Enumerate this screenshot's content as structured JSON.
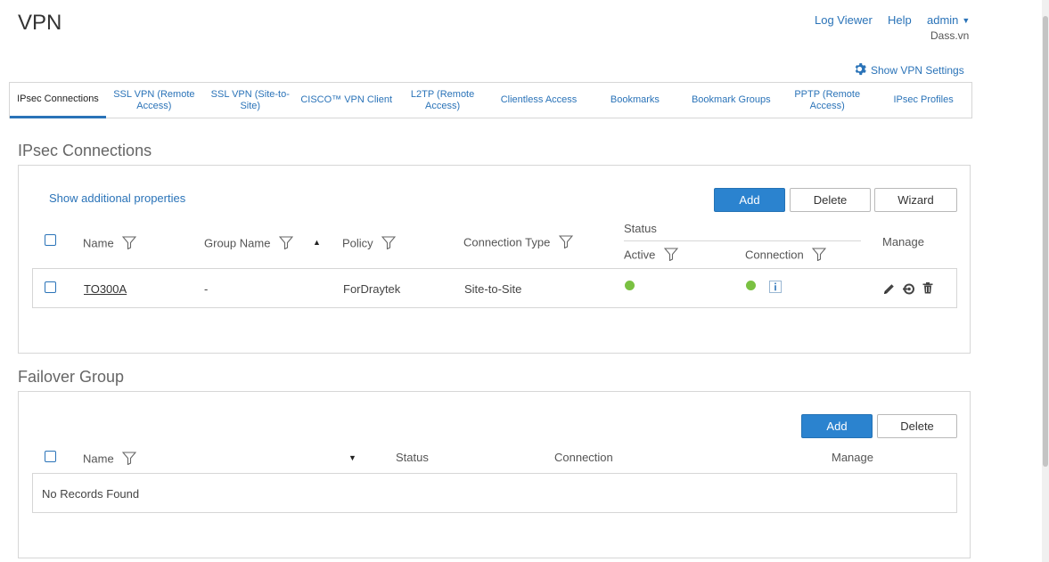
{
  "page": {
    "title": "VPN"
  },
  "header": {
    "log_viewer": "Log Viewer",
    "help": "Help",
    "user": "admin",
    "org": "Dass.vn",
    "show_vpn_settings": "Show VPN Settings"
  },
  "tabs": [
    {
      "label": "IPsec Connections",
      "active": true
    },
    {
      "label": "SSL VPN (Remote Access)"
    },
    {
      "label": "SSL VPN (Site-to-Site)"
    },
    {
      "label": "CISCO™ VPN Client"
    },
    {
      "label": "L2TP (Remote Access)"
    },
    {
      "label": "Clientless Access"
    },
    {
      "label": "Bookmarks"
    },
    {
      "label": "Bookmark Groups"
    },
    {
      "label": "PPTP (Remote Access)"
    },
    {
      "label": "IPsec Profiles"
    }
  ],
  "ipsec": {
    "title": "IPsec Connections",
    "show_additional": "Show additional properties",
    "buttons": {
      "add": "Add",
      "delete": "Delete",
      "wizard": "Wizard"
    },
    "columns": {
      "name": "Name",
      "group_name": "Group Name",
      "policy": "Policy",
      "connection_type": "Connection Type",
      "status": "Status",
      "active": "Active",
      "connection": "Connection",
      "manage": "Manage"
    },
    "rows": [
      {
        "name": "TO300A",
        "group_name": "-",
        "policy": "ForDraytek",
        "connection_type": "Site-to-Site",
        "active_color": "#7ac142",
        "connection_color": "#7ac142"
      }
    ]
  },
  "failover": {
    "title": "Failover Group",
    "buttons": {
      "add": "Add",
      "delete": "Delete"
    },
    "columns": {
      "name": "Name",
      "status": "Status",
      "connection": "Connection",
      "manage": "Manage"
    },
    "empty": "No Records Found"
  },
  "colors": {
    "accent": "#2a73b8",
    "primary_button": "#2b83cf",
    "status_ok": "#7ac142"
  }
}
